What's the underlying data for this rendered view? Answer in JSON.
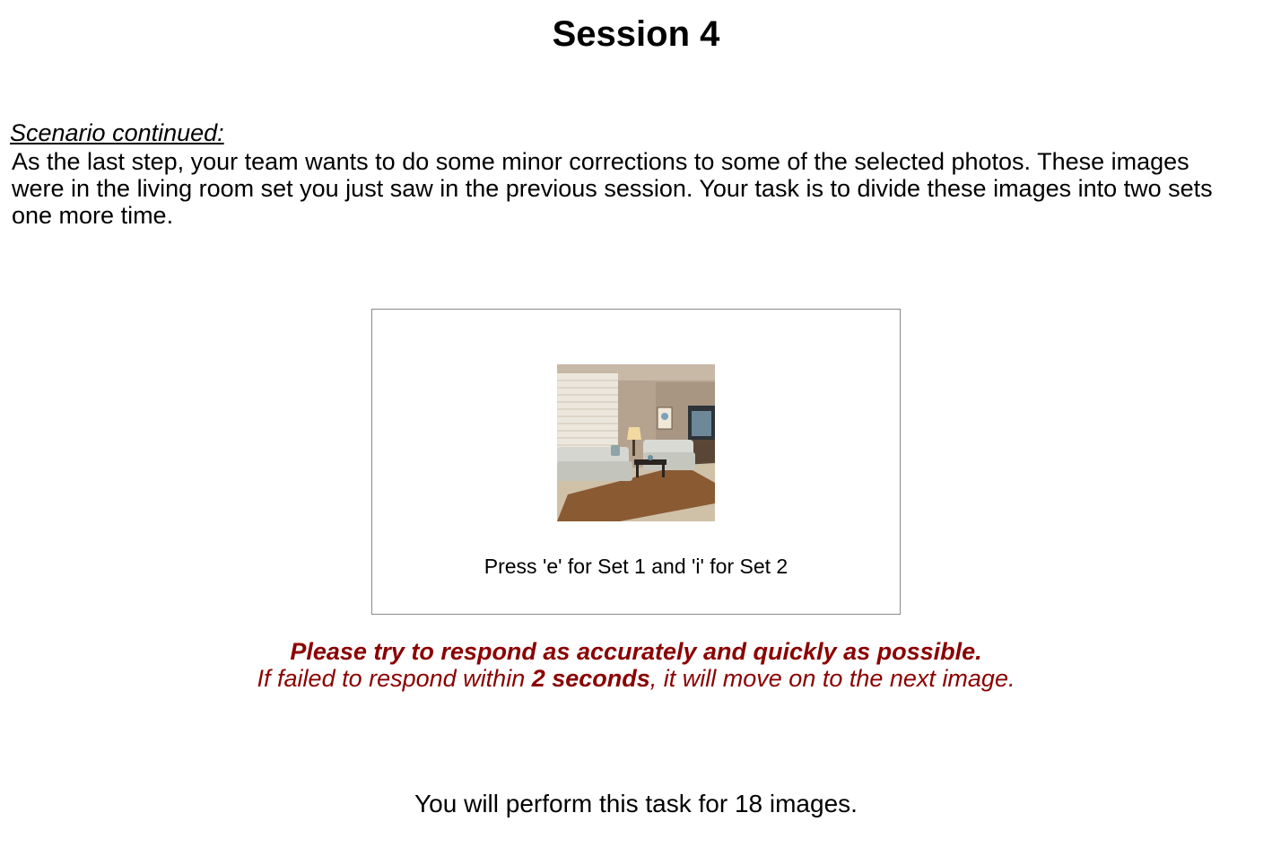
{
  "header": {
    "title": "Session 4"
  },
  "scenario": {
    "heading": "Scenario continued:",
    "text": "As the last step, your team wants to do some minor corrections to some of the selected photos. These images were in the living room set you just saw in the previous session. Your task is to divide these images into two sets one more time."
  },
  "stimulus": {
    "image_subject": "living room photo",
    "key_instruction": "Press 'e' for Set 1 and 'i' for Set 2"
  },
  "warning": {
    "line1": "Please try to respond as accurately and quickly as possible.",
    "line2_before": "If failed to respond within ",
    "line2_bold": "2 seconds",
    "line2_after": ", it will move on to the next image.",
    "color": "#8b0000"
  },
  "footer": {
    "text": "You will perform this task for 18 images."
  }
}
